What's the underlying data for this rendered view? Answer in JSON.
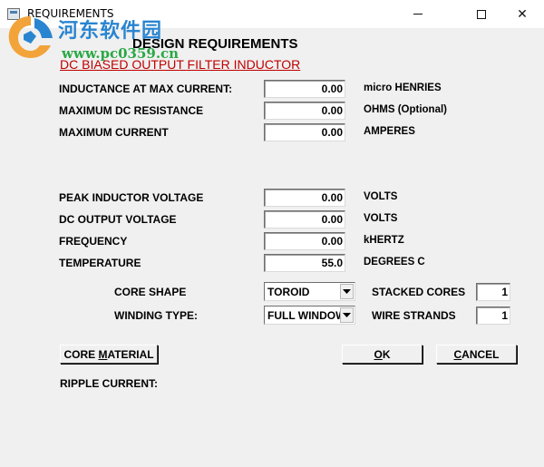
{
  "window": {
    "title": "REQUIREMENTS",
    "min_glyph": "—",
    "close_glyph": "✕"
  },
  "watermark": {
    "title": "河东软件园",
    "url": "www.pc0359.cn"
  },
  "dialog": {
    "heading": "DESIGN REQUIREMENTS",
    "subheading": "DC BIASED OUTPUT FILTER INDUCTOR"
  },
  "fields": {
    "inductance": {
      "label": "INDUCTANCE AT MAX CURRENT:",
      "value": "0.00",
      "unit": "micro HENRIES"
    },
    "max_dc_resistance": {
      "label": "MAXIMUM DC RESISTANCE",
      "value": "0.00",
      "unit": "OHMS (Optional)"
    },
    "max_current": {
      "label": "MAXIMUM CURRENT",
      "value": "0.00",
      "unit": "AMPERES"
    },
    "peak_inductor_voltage": {
      "label": "PEAK INDUCTOR VOLTAGE",
      "value": "0.00",
      "unit": "VOLTS"
    },
    "dc_output_voltage": {
      "label": "DC OUTPUT VOLTAGE",
      "value": "0.00",
      "unit": "VOLTS"
    },
    "frequency": {
      "label": "FREQUENCY",
      "value": "0.00",
      "unit": "kHERTZ"
    },
    "temperature": {
      "label": "TEMPERATURE",
      "value": "55.0",
      "unit": "DEGREES C"
    }
  },
  "core_shape": {
    "label": "CORE SHAPE",
    "selected": "TOROID"
  },
  "winding_type": {
    "label": "WINDING TYPE:",
    "selected": "FULL WINDOW"
  },
  "stacked_cores": {
    "label": "STACKED CORES",
    "value": "1"
  },
  "wire_strands": {
    "label": "WIRE STRANDS",
    "value": "1"
  },
  "buttons": {
    "core_material": {
      "pre": "CORE ",
      "ul": "M",
      "post": "ATERIAL"
    },
    "ok": {
      "pre": "",
      "ul": "O",
      "post": "K"
    },
    "cancel": {
      "pre": "",
      "ul": "C",
      "post": "ANCEL"
    }
  },
  "ripple_current": {
    "label": "RIPPLE CURRENT:"
  },
  "colors": {
    "background": "#f0f0f0",
    "subheading": "#c00000",
    "watermark_blue": "#2a85d0",
    "watermark_green": "#2aa845"
  }
}
